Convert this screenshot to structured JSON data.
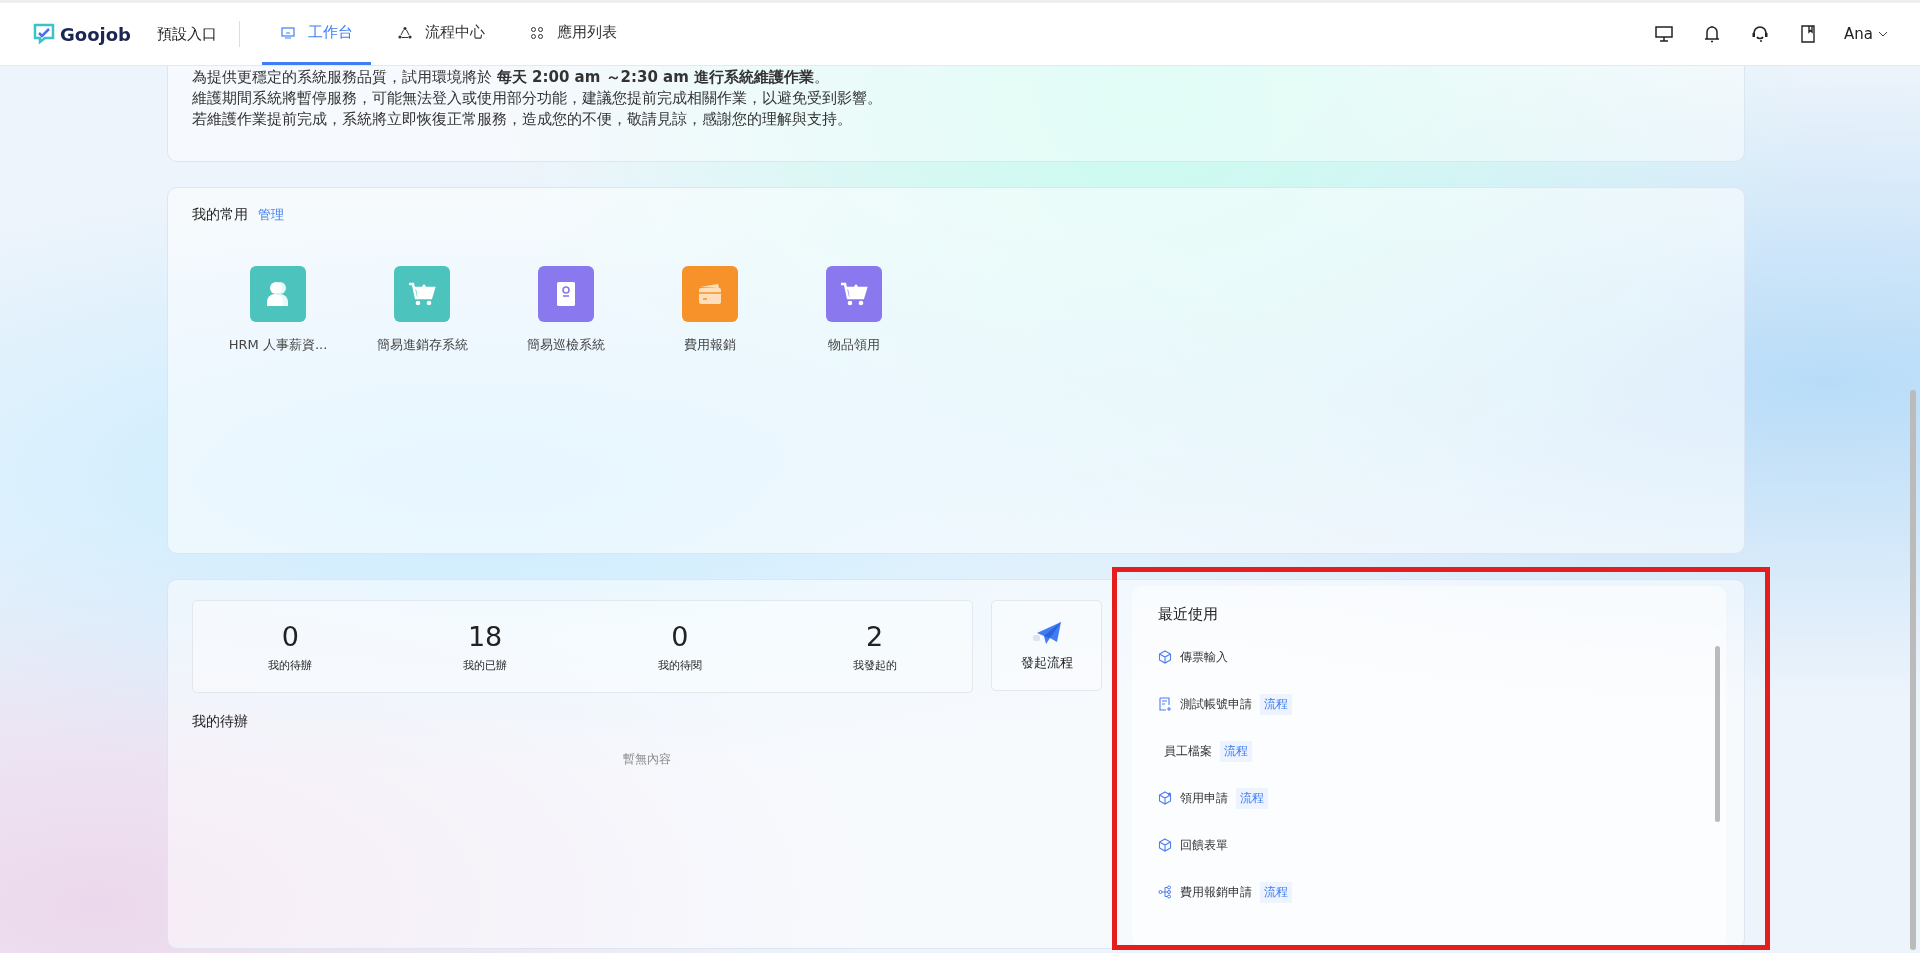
{
  "header": {
    "logo": "Goojob",
    "entry": "預設入口",
    "tabs": [
      {
        "label": "工作台",
        "kind": "monitor",
        "selected": true
      },
      {
        "label": "流程中心",
        "kind": "nodes",
        "selected": false
      },
      {
        "label": "應用列表",
        "kind": "grid",
        "selected": false
      }
    ],
    "user": "Ana"
  },
  "notice": {
    "lines": [
      "為提供更穩定的系統服務品質，試用環境將於 **每天 2:00 am ～2:30 am 進行系統維護作業**。",
      "維護期間系統將暫停服務，可能無法登入或使用部分功能，建議您提前完成相關作業，以避免受到影響。",
      "若維護作業提前完成，系統將立即恢復正常服務，造成您的不便，敬請見諒，感謝您的理解與支持。"
    ]
  },
  "favorites": {
    "title": "我的常用",
    "manage": "管理",
    "apps": [
      {
        "label": "HRM 人事薪資...",
        "kind": "people",
        "color": "#4cc3bc"
      },
      {
        "label": "簡易進銷存系統",
        "kind": "cart",
        "color": "#4cc3bc"
      },
      {
        "label": "簡易巡檢系統",
        "kind": "badge",
        "color": "#8a78ee"
      },
      {
        "label": "費用報銷",
        "kind": "card",
        "color": "#f7922a"
      },
      {
        "label": "物品領用",
        "kind": "cart",
        "color": "#8a78ee"
      }
    ]
  },
  "stats": [
    {
      "value": "0",
      "label": "我的待辦"
    },
    {
      "value": "18",
      "label": "我的已辦"
    },
    {
      "value": "0",
      "label": "我的待閱"
    },
    {
      "value": "2",
      "label": "我發起的"
    }
  ],
  "launch": "發起流程",
  "todo": {
    "title": "我的待辦",
    "empty": "暫無內容"
  },
  "recent": {
    "title": "最近使用",
    "items": [
      {
        "name": "傳票輸入",
        "kind": "cube"
      },
      {
        "name": "測試帳號申請",
        "kind": "doc",
        "tag": "流程"
      },
      {
        "name": "員工檔案",
        "kind": "none",
        "tag": "流程"
      },
      {
        "name": "領用申請",
        "kind": "cube-gear",
        "tag": "流程"
      },
      {
        "name": "回饋表單",
        "kind": "cube"
      },
      {
        "name": "費用報銷申請",
        "kind": "flow",
        "tag": "流程"
      }
    ]
  }
}
